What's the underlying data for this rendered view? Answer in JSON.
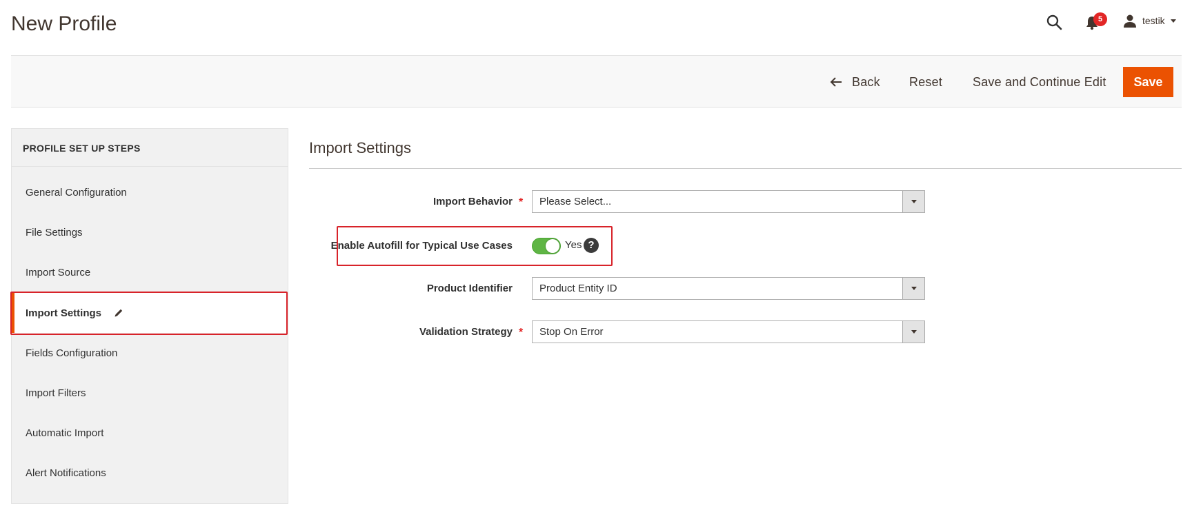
{
  "header": {
    "title": "New Profile",
    "notifications_count": "5",
    "user_name": "testik"
  },
  "toolbar": {
    "back_label": "Back",
    "reset_label": "Reset",
    "save_continue_label": "Save and Continue Edit",
    "save_label": "Save"
  },
  "sidebar": {
    "title": "PROFILE SET UP STEPS",
    "items": [
      {
        "label": "General Configuration"
      },
      {
        "label": "File Settings"
      },
      {
        "label": "Import Source"
      },
      {
        "label": "Import Settings"
      },
      {
        "label": "Fields Configuration"
      },
      {
        "label": "Import Filters"
      },
      {
        "label": "Automatic Import"
      },
      {
        "label": "Alert Notifications"
      }
    ]
  },
  "main": {
    "section_title": "Import Settings",
    "fields": {
      "import_behavior": {
        "label": "Import Behavior",
        "value": "Please Select..."
      },
      "autofill": {
        "label": "Enable Autofill for Typical Use Cases",
        "value": "Yes",
        "help": "?"
      },
      "product_identifier": {
        "label": "Product Identifier",
        "value": "Product Entity ID"
      },
      "validation_strategy": {
        "label": "Validation Strategy",
        "value": "Stop On Error"
      }
    }
  },
  "colors": {
    "primary_button": "#eb5202",
    "toggle_on": "#5fb545",
    "highlight": "#d8232a",
    "required": "#e22626"
  }
}
